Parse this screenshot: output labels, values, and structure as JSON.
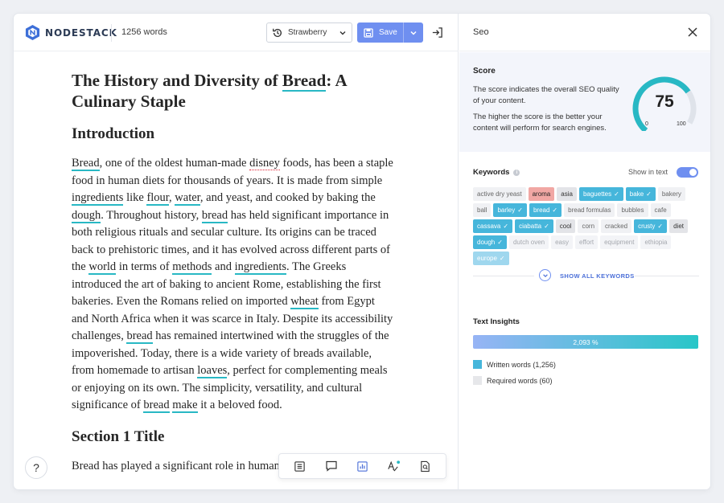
{
  "header": {
    "brand": "NODESTACK",
    "word_count": "1256 words",
    "version_select": "Strawberry",
    "save_label": "Save"
  },
  "document": {
    "title_parts": [
      "The History and Diversity of ",
      "Bread",
      ": A Culinary Staple"
    ],
    "h_intro": "Introduction",
    "p1": [
      {
        "t": "Bread",
        "k": 1
      },
      {
        "t": ", one of the oldest human-made "
      },
      {
        "t": "disney",
        "s": 1
      },
      {
        "t": " foods, has been a staple food in human diets for thousands of years. It is made from simple "
      },
      {
        "t": "ingredients",
        "k": 1
      },
      {
        "t": " like "
      },
      {
        "t": "flour",
        "k": 1
      },
      {
        "t": ", "
      },
      {
        "t": "water",
        "k": 1
      },
      {
        "t": ", and yeast, and cooked by baking the "
      },
      {
        "t": "dough",
        "k": 1
      },
      {
        "t": ". Throughout history, "
      },
      {
        "t": "bread",
        "k": 1
      },
      {
        "t": " has held significant importance in both religious rituals and secular culture. Its origins can be traced back to prehistoric times, and it has evolved across different parts of the "
      },
      {
        "t": "world",
        "k": 1
      },
      {
        "t": " in terms of "
      },
      {
        "t": "methods",
        "k": 1
      },
      {
        "t": " and "
      },
      {
        "t": "ingredients",
        "k": 1
      },
      {
        "t": ". The Greeks introduced the art of baking to ancient Rome, establishing the first bakeries. Even the Romans relied on imported "
      },
      {
        "t": "wheat",
        "k": 1
      },
      {
        "t": " from Egypt and North Africa when it was scarce in Italy. Despite its accessibility challenges, "
      },
      {
        "t": "bread",
        "k": 1
      },
      {
        "t": " has remained intertwined with the struggles of the impoverished. Today, there is a wide variety of breads available, from homemade to artisan "
      },
      {
        "t": "loaves",
        "k": 1
      },
      {
        "t": ", perfect for complementing meals or enjoying on its own. The simplicity, versatility, and cultural significance of "
      },
      {
        "t": "bread",
        "k": 1
      },
      {
        "t": " "
      },
      {
        "t": "make",
        "k": 1
      },
      {
        "t": " it a beloved food."
      }
    ],
    "h_section1": "Section 1 Title",
    "p2": "Bread has played a significant role in human civilization, with"
  },
  "help_label": "?",
  "toolbar_icons": [
    "outline-icon",
    "comment-icon",
    "chart-icon",
    "spellcheck-icon",
    "search-document-icon"
  ],
  "seo": {
    "title": "Seo",
    "score_title": "Score",
    "score_desc1": "The score indicates the overall SEO quality of your content.",
    "score_desc2": "The higher the score is the better your content will perform for search engines.",
    "score": 75,
    "score_value": "75",
    "score_min": "0",
    "score_max": "100",
    "keywords_title": "Keywords",
    "show_in_text": "Show in text",
    "show_in_text_on": true,
    "keywords": [
      {
        "label": "active dry yeast",
        "state": "plain"
      },
      {
        "label": "aroma",
        "state": "red"
      },
      {
        "label": "asia",
        "state": "gray"
      },
      {
        "label": "baguettes",
        "state": "blue"
      },
      {
        "label": "bake",
        "state": "blue"
      },
      {
        "label": "bakery",
        "state": "plain"
      },
      {
        "label": "ball",
        "state": "plain"
      },
      {
        "label": "barley",
        "state": "blue"
      },
      {
        "label": "bread",
        "state": "blue"
      },
      {
        "label": "bread formulas",
        "state": "plain"
      },
      {
        "label": "bubbles",
        "state": "plain"
      },
      {
        "label": "cafe",
        "state": "plain"
      },
      {
        "label": "cassava",
        "state": "blue"
      },
      {
        "label": "ciabatta",
        "state": "blue"
      },
      {
        "label": "cool",
        "state": "gray"
      },
      {
        "label": "corn",
        "state": "plain"
      },
      {
        "label": "cracked",
        "state": "plain"
      },
      {
        "label": "crusty",
        "state": "blue"
      },
      {
        "label": "diet",
        "state": "gray"
      },
      {
        "label": "dough",
        "state": "blue"
      },
      {
        "label": "dutch oven",
        "state": "faded"
      },
      {
        "label": "easy",
        "state": "faded"
      },
      {
        "label": "effort",
        "state": "faded"
      },
      {
        "label": "equipment",
        "state": "faded"
      },
      {
        "label": "ethiopia",
        "state": "faded"
      },
      {
        "label": "europe",
        "state": "fadeblue"
      }
    ],
    "show_all": "SHOW ALL KEYWORDS",
    "insights_title": "Text Insights",
    "insights_bar": "2,093 %",
    "written_words": "Written words (1,256)",
    "required_words": "Required words (60)",
    "colors": {
      "accent": "#6f8ff0",
      "keyword": "#28b8c4",
      "written": "#46b6db",
      "required": "#e6e7ea"
    }
  }
}
